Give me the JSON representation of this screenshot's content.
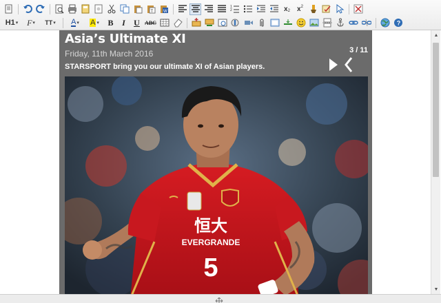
{
  "toolbar": {
    "row1": [
      "source",
      "undo",
      "redo",
      "preview",
      "print",
      "templates",
      "new-page",
      "cut",
      "copy",
      "paste",
      "paste-text",
      "paste-word",
      "align-left",
      "align-center",
      "align-right",
      "justify",
      "numbered-list",
      "bulleted-list",
      "indent",
      "outdent",
      "subscript",
      "superscript",
      "format-painter",
      "spellcheck",
      "select",
      "maximize"
    ],
    "heading_label": "H1",
    "font_label": "F",
    "size_label": "TT",
    "bold_label": "B",
    "italic_label": "I",
    "underline_label": "U",
    "strike_label": "ABC",
    "subscript_label": "x",
    "superscript_label": "x"
  },
  "gallery": {
    "title": "Asia’s Ultimate XI",
    "date": "Friday, 11th March 2016",
    "description": "STARSPORT bring you our ultimate XI of Asian players.",
    "counter": "3 / 11",
    "jersey": {
      "sponsor_cn": "恒大",
      "sponsor": "EVERGRANDE",
      "number": "5",
      "shirt_color": "#c4141b"
    }
  },
  "colors": {
    "gallery_bg": "#6b6b6b",
    "toolbar_bg": "#efefef",
    "accent": "#1e6fc8"
  }
}
